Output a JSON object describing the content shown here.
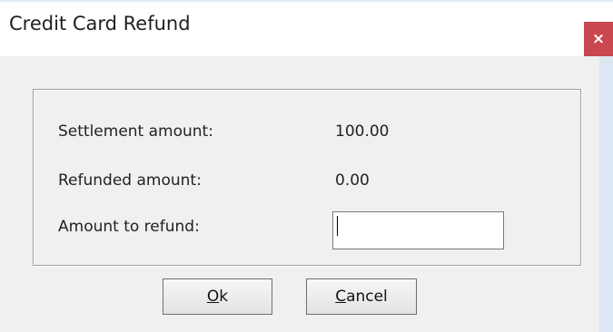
{
  "window": {
    "title": "Credit Card Refund",
    "close_label": "×"
  },
  "form": {
    "settlement_label": "Settlement amount:",
    "settlement_value": "100.00",
    "refunded_label": "Refunded amount:",
    "refunded_value": "0.00",
    "refund_label": "Amount to refund:",
    "refund_input_value": ""
  },
  "buttons": {
    "ok_accel": "O",
    "ok_rest": "k",
    "cancel_accel": "C",
    "cancel_rest": "ancel"
  },
  "colors": {
    "close_button": "#c9474f",
    "dialog_background": "#f0f0f0",
    "desktop_background": "#dce7f3"
  }
}
